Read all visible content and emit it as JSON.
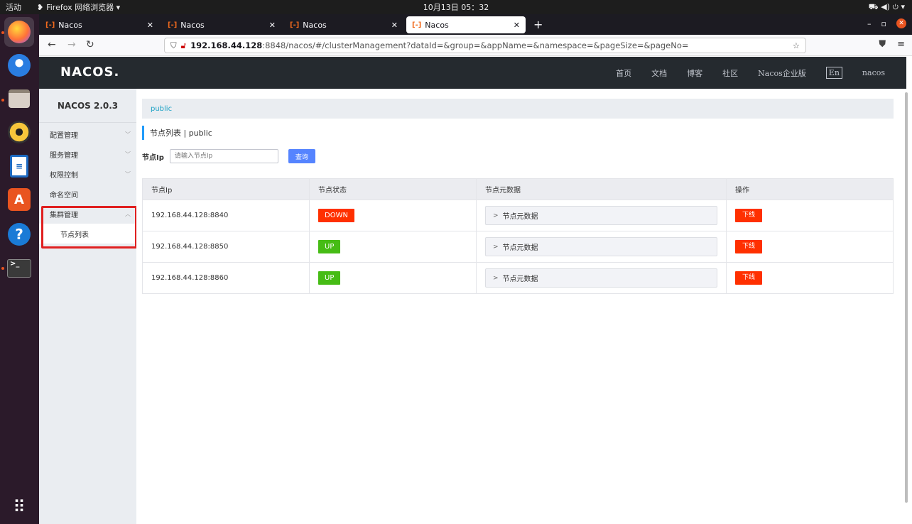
{
  "topbar": {
    "activities": "活动",
    "app_name": "Firefox 网络浏览器 ▾",
    "clock": "10月13日  05：32",
    "tray": "⛟  ◀)  ⏻ ▾"
  },
  "dock": {
    "apps": [
      "firefox-icon",
      "thunderbird-icon",
      "files-icon",
      "rhythmbox-icon",
      "writer-icon",
      "software-icon",
      "help-icon",
      "terminal-icon"
    ],
    "show_apps": "⠿"
  },
  "browser": {
    "tabs": [
      {
        "label": "Nacos",
        "active": false
      },
      {
        "label": "Nacos",
        "active": false
      },
      {
        "label": "Nacos",
        "active": false
      },
      {
        "label": "Nacos",
        "active": true
      }
    ],
    "new_tab": "+",
    "url_host": "192.168.44.128",
    "url_rest": ":8848/nacos/#/clusterManagement?dataId=&group=&appName=&namespace=&pageSize=&pageNo="
  },
  "nacos_header": {
    "logo": "NACOS.",
    "menu": [
      "首页",
      "文档",
      "博客",
      "社区",
      "Nacos企业版"
    ],
    "lang": "En",
    "user": "nacos"
  },
  "sidebar": {
    "title": "NACOS 2.0.3",
    "items": [
      {
        "label": "配置管理",
        "chevron": "﹀"
      },
      {
        "label": "服务管理",
        "chevron": "﹀"
      },
      {
        "label": "权限控制",
        "chevron": "﹀"
      },
      {
        "label": "命名空间",
        "chevron": ""
      },
      {
        "label": "集群管理",
        "chevron": "︿"
      }
    ],
    "sub_item": "节点列表"
  },
  "main": {
    "namespace": "public",
    "page_title": "节点列表 | public",
    "search_label": "节点Ip",
    "search_placeholder": "请输入节点Ip",
    "query_button": "查询",
    "columns": [
      "节点Ip",
      "节点状态",
      "节点元数据",
      "操作"
    ],
    "rows": [
      {
        "ip": "192.168.44.128:8840",
        "status": "DOWN",
        "metadata": "节点元数据",
        "action": "下线"
      },
      {
        "ip": "192.168.44.128:8850",
        "status": "UP",
        "metadata": "节点元数据",
        "action": "下线"
      },
      {
        "ip": "192.168.44.128:8860",
        "status": "UP",
        "metadata": "节点元数据",
        "action": "下线"
      }
    ]
  },
  "colors": {
    "header_bg": "#252a2f",
    "status_down": "#ff3000",
    "status_up": "#46bc15",
    "primary": "#5584ff",
    "highlight_box": "#e02020"
  }
}
